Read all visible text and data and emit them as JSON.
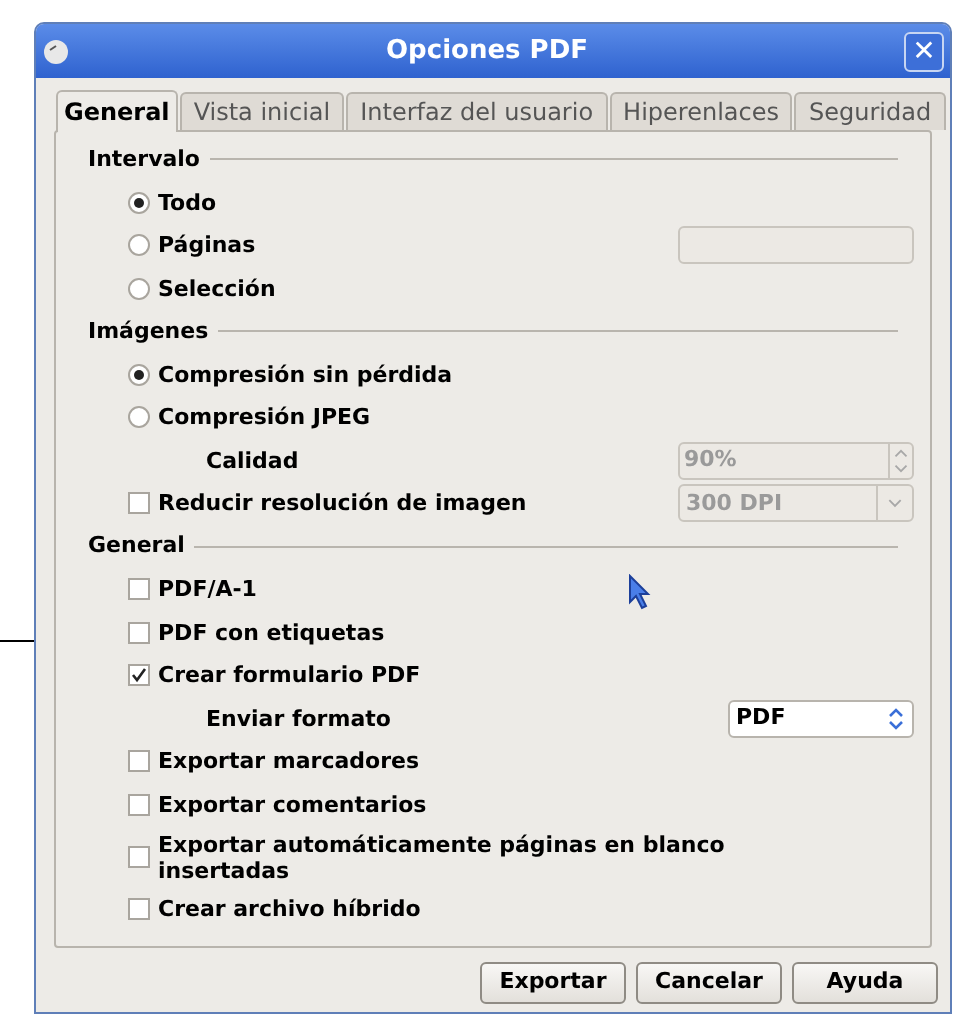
{
  "window": {
    "title": "Opciones PDF",
    "close": "✕"
  },
  "tabs": [
    {
      "label": "General",
      "selected": true
    },
    {
      "label": "Vista inicial",
      "selected": false
    },
    {
      "label": "Interfaz del usuario",
      "selected": false
    },
    {
      "label": "Hiperenlaces",
      "selected": false
    },
    {
      "label": "Seguridad",
      "selected": false
    }
  ],
  "sections": [
    {
      "heading": "Intervalo",
      "items": [
        {
          "kind": "radio",
          "label": "Todo",
          "selected": true
        },
        {
          "kind": "radio",
          "label": "Páginas",
          "selected": false,
          "field": {
            "kind": "text",
            "disabled": true
          }
        },
        {
          "kind": "radio",
          "label": "Selección",
          "selected": false
        }
      ]
    },
    {
      "heading": "Imágenes",
      "items": [
        {
          "kind": "radio",
          "label": "Compresión sin pérdida",
          "selected": true
        },
        {
          "kind": "radio",
          "label": "Compresión JPEG",
          "selected": false
        },
        {
          "kind": "label",
          "label": "Calidad",
          "field": {
            "kind": "spin",
            "value": "90%",
            "disabled": true
          }
        },
        {
          "kind": "checkbox",
          "label": "Reducir resolución de imagen",
          "checked": false,
          "field": {
            "kind": "dropdown",
            "value": "300 DPI",
            "disabled": true
          }
        }
      ]
    },
    {
      "heading": "General",
      "items": [
        {
          "kind": "checkbox",
          "label": "PDF/A-1",
          "checked": false
        },
        {
          "kind": "checkbox",
          "label": "PDF con etiquetas",
          "checked": false
        },
        {
          "kind": "checkbox",
          "label": "Crear formulario PDF",
          "checked": true
        },
        {
          "kind": "label",
          "label": "Enviar formato",
          "field": {
            "kind": "select",
            "value": "PDF",
            "disabled": false
          }
        },
        {
          "kind": "checkbox",
          "label": "Exportar marcadores",
          "checked": false
        },
        {
          "kind": "checkbox",
          "label": "Exportar comentarios",
          "checked": false
        },
        {
          "kind": "checkbox",
          "label": "Exportar automáticamente páginas en blanco insertadas",
          "checked": false
        },
        {
          "kind": "checkbox",
          "label": "Crear archivo híbrido",
          "checked": false
        }
      ]
    }
  ],
  "buttons": [
    "Exportar",
    "Cancelar",
    "Ayuda"
  ]
}
